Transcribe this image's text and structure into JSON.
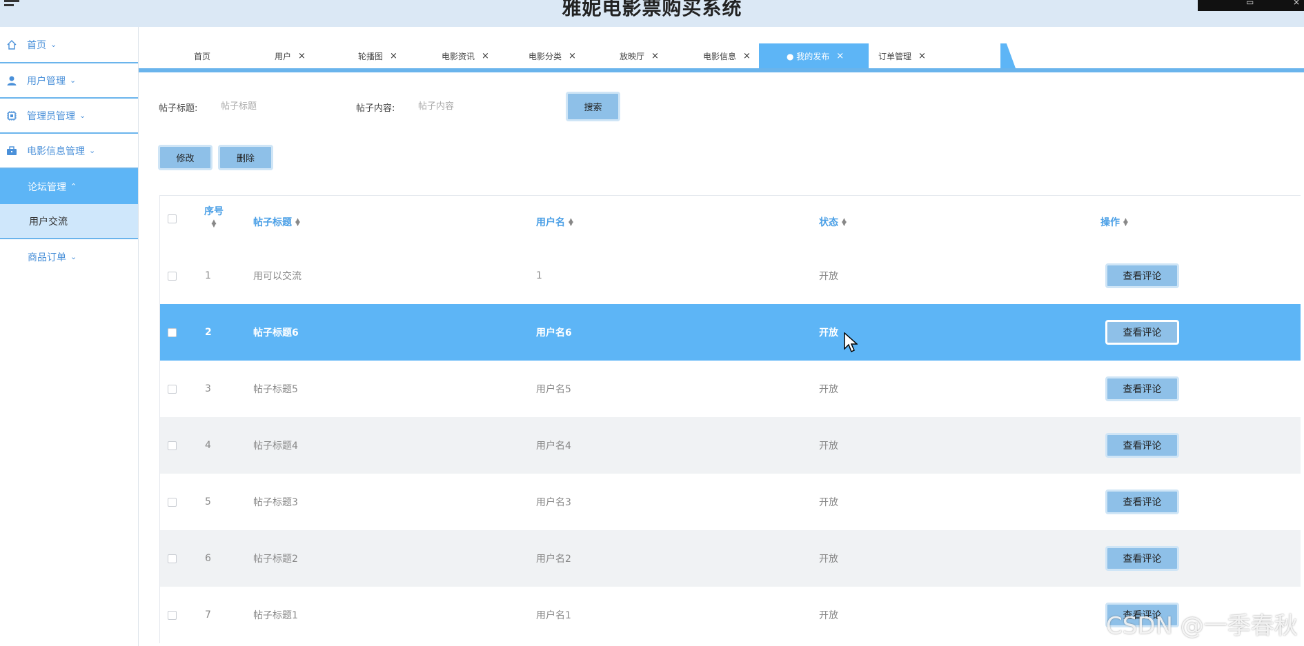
{
  "header": {
    "title": "雅妮电影票购买系统"
  },
  "sidebar": {
    "items": [
      {
        "label": "首页",
        "icon": "home-icon"
      },
      {
        "label": "用户管理",
        "icon": "user-icon"
      },
      {
        "label": "管理员管理",
        "icon": "cpu-icon"
      },
      {
        "label": "电影信息管理",
        "icon": "briefcase-icon"
      }
    ],
    "active": {
      "label": "论坛管理"
    },
    "sub": {
      "label": "用户交流"
    },
    "last": {
      "label": "商品订单"
    }
  },
  "tabs": [
    {
      "label": "首页"
    },
    {
      "label": "用户"
    },
    {
      "label": "轮播图"
    },
    {
      "label": "电影资讯"
    },
    {
      "label": "电影分类"
    },
    {
      "label": "放映厅"
    },
    {
      "label": "电影信息"
    },
    {
      "label": "● 我的发布"
    },
    {
      "label": "订单管理"
    }
  ],
  "tab_close": "×",
  "search": {
    "title_label": "帖子标题:",
    "title_placeholder": "帖子标题",
    "content_label": "帖子内容:",
    "content_placeholder": "帖子内容",
    "button": "搜索"
  },
  "actions": {
    "edit": "修改",
    "delete": "删除"
  },
  "table": {
    "headers": {
      "index": "序号",
      "title": "帖子标题",
      "username": "用户名",
      "status": "状态",
      "op": "操作"
    },
    "rows": [
      {
        "index": "1",
        "title": "用可以交流",
        "username": "1",
        "status": "开放",
        "op": "查看评论"
      },
      {
        "index": "2",
        "title": "帖子标题6",
        "username": "用户名6",
        "status": "开放",
        "op": "查看评论"
      },
      {
        "index": "3",
        "title": "帖子标题5",
        "username": "用户名5",
        "status": "开放",
        "op": "查看评论"
      },
      {
        "index": "4",
        "title": "帖子标题4",
        "username": "用户名4",
        "status": "开放",
        "op": "查看评论"
      },
      {
        "index": "5",
        "title": "帖子标题3",
        "username": "用户名3",
        "status": "开放",
        "op": "查看评论"
      },
      {
        "index": "6",
        "title": "帖子标题2",
        "username": "用户名2",
        "status": "开放",
        "op": "查看评论"
      },
      {
        "index": "7",
        "title": "帖子标题1",
        "username": "用户名1",
        "status": "开放",
        "op": "查看评论"
      }
    ]
  },
  "watermark": "CSDN @一季春秋",
  "colors": {
    "accent": "#5db5f6",
    "button": "#8ec0e8",
    "header_bg": "#dbe8f5",
    "link": "#4a90d9"
  }
}
